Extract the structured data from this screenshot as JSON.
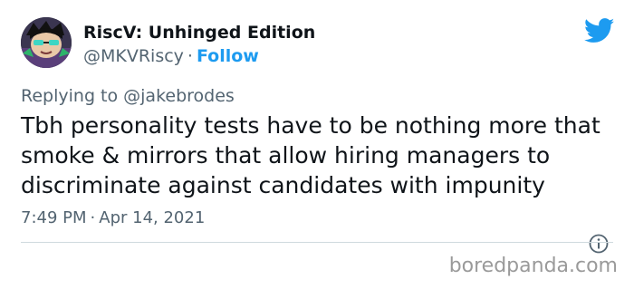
{
  "tweet": {
    "author": {
      "display_name": "RiscV: Unhinged Edition",
      "handle": "@MKVRiscy",
      "separator": "·",
      "follow_label": "Follow",
      "avatar_icon": "cartoon-avatar"
    },
    "brand_icon": "twitter-bird-icon",
    "reply": {
      "prefix": "Replying to ",
      "mention": "@jakebrodes"
    },
    "text_lines": [
      "Tbh personality tests have to be nothing more that",
      "smoke & mirrors that allow hiring managers to",
      "discriminate against candidates with impunity"
    ],
    "time": "7:49 PM",
    "separator": "·",
    "date": "Apr 14, 2021",
    "info_icon": "info-icon"
  },
  "watermark": "boredpanda.com",
  "colors": {
    "accent": "#1d9bf0",
    "text": "#0f1419",
    "muted": "#536471",
    "divider": "#cfd9de",
    "watermark": "#9a9a9a"
  }
}
